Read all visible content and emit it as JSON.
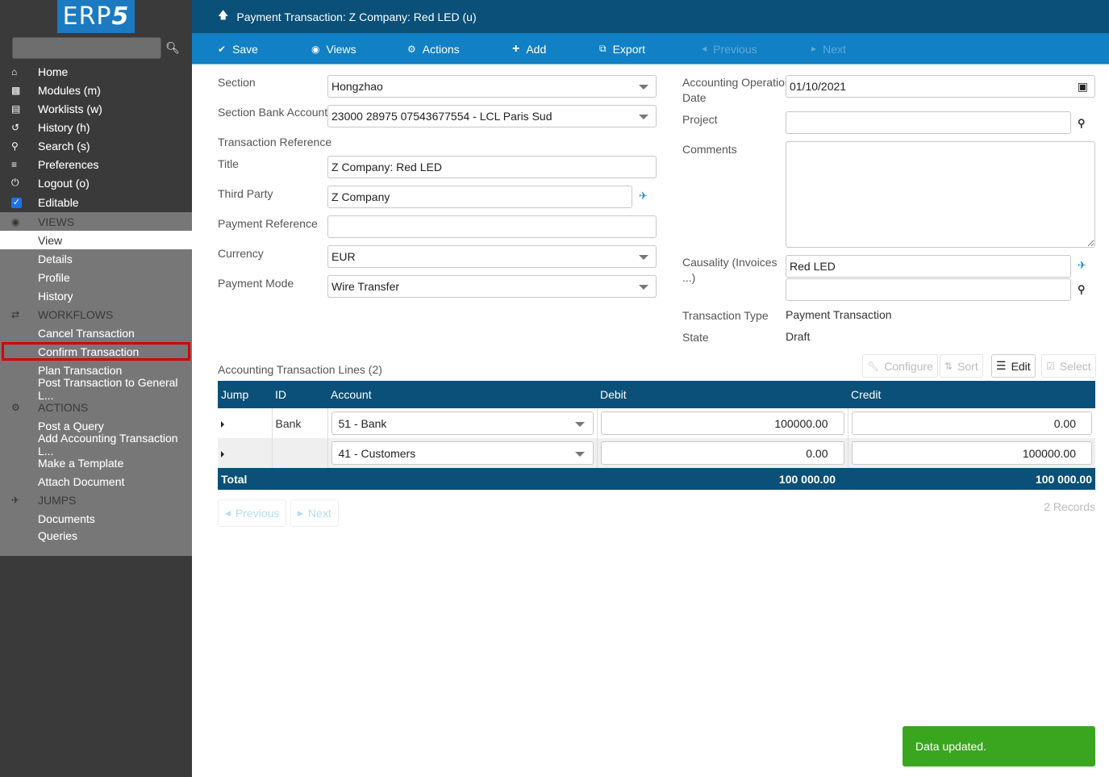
{
  "sidebar": {
    "logo": "ERP",
    "logo_five": "5",
    "search_placeholder": "",
    "nav": [
      {
        "label": "Home",
        "icon": "home-icon"
      },
      {
        "label": "Modules (m)",
        "icon": "puzzle-icon"
      },
      {
        "label": "Worklists (w)",
        "icon": "tasks-icon"
      },
      {
        "label": "History (h)",
        "icon": "history-icon"
      },
      {
        "label": "Search (s)",
        "icon": "search-icon"
      },
      {
        "label": "Preferences",
        "icon": "sliders-icon"
      },
      {
        "label": "Logout (o)",
        "icon": "power-icon"
      },
      {
        "label": "Editable",
        "icon": "checkbox-icon",
        "checked": true
      }
    ],
    "views": {
      "title": "VIEWS",
      "items": [
        "View",
        "Details",
        "Profile",
        "History"
      ],
      "active": "View"
    },
    "workflows": {
      "title": "WORKFLOWS",
      "items": [
        "Cancel Transaction",
        "Confirm Transaction",
        "Plan Transaction",
        "Post Transaction to General L..."
      ],
      "highlighted": "Confirm Transaction"
    },
    "actions": {
      "title": "ACTIONS",
      "items": [
        "Post a Query",
        "Add Accounting Transaction L...",
        "Make a Template",
        "Attach Document"
      ]
    },
    "jumps": {
      "title": "JUMPS",
      "items": [
        "Documents",
        "Queries"
      ]
    }
  },
  "header": {
    "title": "Payment Transaction: Z Company: Red LED (u)"
  },
  "toolbar": {
    "save": "Save",
    "views": "Views",
    "actions": "Actions",
    "add": "Add",
    "export": "Export",
    "previous": "Previous",
    "next": "Next"
  },
  "form": {
    "left": {
      "section": {
        "label": "Section",
        "value": "Hongzhao"
      },
      "section_bank_account": {
        "label": "Section Bank Account",
        "value": "23000 28975 07543677554 - LCL Paris Sud"
      },
      "transaction_reference": {
        "label": "Transaction Reference"
      },
      "title": {
        "label": "Title",
        "value": "Z Company: Red LED"
      },
      "third_party": {
        "label": "Third Party",
        "value": "Z Company"
      },
      "payment_reference": {
        "label": "Payment Reference",
        "value": ""
      },
      "currency": {
        "label": "Currency",
        "value": "EUR"
      },
      "payment_mode": {
        "label": "Payment Mode",
        "value": "Wire Transfer"
      }
    },
    "right": {
      "operation_date": {
        "label_line1": "Accounting Operation",
        "label_line2": "Date",
        "value": "01/10/2021"
      },
      "project": {
        "label": "Project",
        "value": ""
      },
      "comments": {
        "label": "Comments",
        "value": ""
      },
      "causality": {
        "label_line1": "Causality (Invoices",
        "label_line2": "...)",
        "value": "Red LED",
        "value2": ""
      },
      "transaction_type": {
        "label": "Transaction Type",
        "value": "Payment Transaction"
      },
      "state": {
        "label": "State",
        "value": "Draft"
      }
    }
  },
  "listbox": {
    "title": "Accounting Transaction Lines (2)",
    "buttons": {
      "configure": "Configure",
      "sort": "Sort",
      "edit": "Edit",
      "select": "Select"
    },
    "columns": [
      "Jump",
      "ID",
      "Account",
      "Debit",
      "Credit"
    ],
    "rows": [
      {
        "id": "Bank",
        "account": "51 - Bank",
        "debit": "100000.00",
        "credit": "0.00"
      },
      {
        "id": "",
        "account": "41 - Customers",
        "debit": "0.00",
        "credit": "100000.00"
      }
    ],
    "footer": {
      "label": "Total",
      "debit": "100 000.00",
      "credit": "100 000.00"
    },
    "pager": {
      "previous": "Previous",
      "next": "Next"
    },
    "records": "2 Records"
  },
  "notification": {
    "message": "Data updated."
  }
}
